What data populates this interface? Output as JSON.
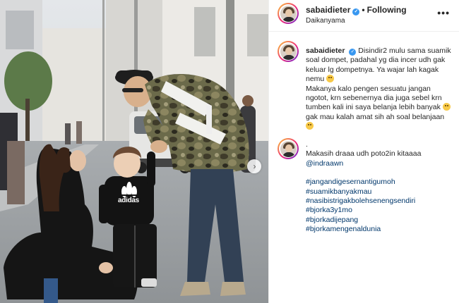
{
  "post": {
    "username": "sabaidieter",
    "follow_status": "Following",
    "separator": "•",
    "location": "Daikanyama",
    "more_icon": "•••",
    "next_icon": "›",
    "photo": {
      "shirt_text": "adidas"
    },
    "caption": {
      "username": "sabaidieter",
      "line1": "Disindir2 mulu sama suamik soal dompet, padahal yg dia incer udh gak keluar lg dompetnya. Ya wajar lah kagak nemu",
      "line2a": "Makanya kalo pengen sesuatu jangan ngotot, krn sebenernya dia juga sebel krn tumben kali ini saya belanja lebih banyak",
      "line2b": "gak mau kalah amat sih ah soal belanjaan"
    },
    "comment": {
      "dot": ".",
      "text": "Makasih draaa udh poto2in kitaaaa",
      "mention": "@indraawn",
      "hashtags": [
        "#jangandigesernantigumoh",
        "#suamikbanyakmau",
        "#nasibistrigakbolehsenengsendiri",
        "#bjorka3y1mo",
        "#bjorkadijepang",
        "#bjorkamengenaldunia"
      ]
    }
  },
  "colors": {
    "link": "#00376b",
    "verified": "#3897f0",
    "text": "#262626"
  }
}
